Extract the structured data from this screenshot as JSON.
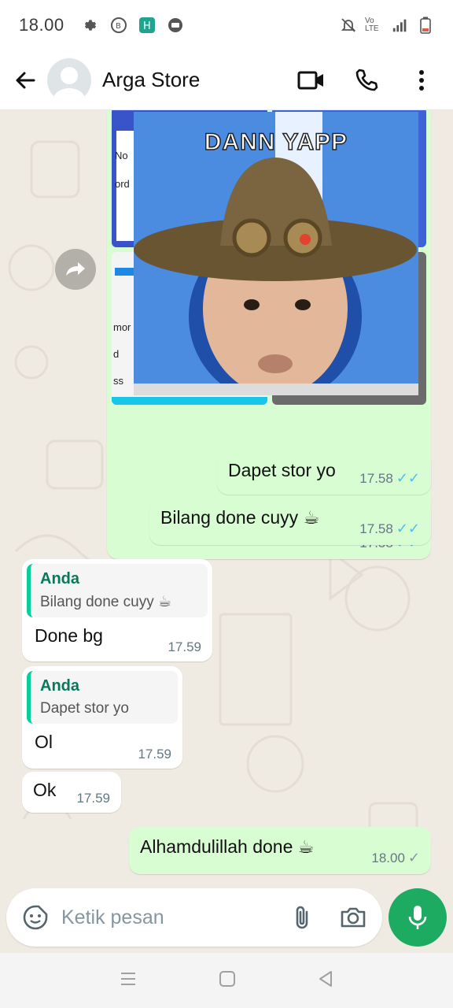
{
  "status_bar": {
    "time": "18.00",
    "network": "Vo LTE"
  },
  "header": {
    "contact_name": "Arga Store"
  },
  "image_message": {
    "caption": "DANN YAPP",
    "time": "17.58",
    "snippet_labels": [
      "No",
      "ord",
      "mor",
      "d",
      "ss"
    ]
  },
  "messages": [
    {
      "text": "Dapet stor yo",
      "time": "17.58",
      "direction": "out",
      "status": "read"
    },
    {
      "text": "Bilang done cuyy ☕",
      "time": "17.58",
      "direction": "out",
      "status": "read"
    },
    {
      "quote_author": "Anda",
      "quote_text": "Bilang done cuyy ☕",
      "text": "Done bg",
      "time": "17.59",
      "direction": "in"
    },
    {
      "quote_author": "Anda",
      "quote_text": "Dapet stor yo",
      "text": "Ol",
      "time": "17.59",
      "direction": "in"
    },
    {
      "text": "Ok",
      "time": "17.59",
      "direction": "in"
    },
    {
      "text": "Alhamdulillah done ☕",
      "time": "18.00",
      "direction": "out",
      "status": "sent"
    }
  ],
  "input": {
    "placeholder": "Ketik pesan"
  },
  "colors": {
    "outgoing_bubble": "#d9fdd3",
    "accent": "#1daa61",
    "read_ticks": "#53bdeb"
  }
}
